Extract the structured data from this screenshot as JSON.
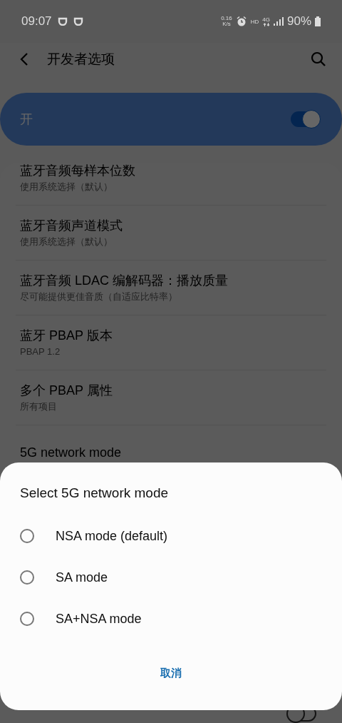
{
  "status_bar": {
    "time": "09:07",
    "speed": "0.16",
    "speed_unit": "K/s",
    "hd": "HD",
    "network": "4G",
    "battery": "90%"
  },
  "header": {
    "title": "开发者选项"
  },
  "master_switch": {
    "label": "开",
    "on": true
  },
  "settings": [
    {
      "kind": "text",
      "title": "蓝牙音频每样本位数",
      "subtitle": "使用系统选择（默认）"
    },
    {
      "kind": "text",
      "title": "蓝牙音频声道模式",
      "subtitle": "使用系统选择（默认）"
    },
    {
      "kind": "text",
      "title": "蓝牙音频 LDAC 编解码器：播放质量",
      "subtitle": "尽可能提供更佳音质（自适应比特率）"
    },
    {
      "kind": "text",
      "title": "蓝牙 PBAP 版本",
      "subtitle": "PBAP 1.2"
    },
    {
      "kind": "text",
      "title": "多个 PBAP 属性",
      "subtitle": "所有项目"
    },
    {
      "kind": "text",
      "title": "5G network mode"
    },
    {
      "kind": "switch",
      "on": false
    }
  ],
  "dialog": {
    "title": "Select 5G network mode",
    "options": [
      {
        "label": "NSA mode (default)",
        "selected": false
      },
      {
        "label": "SA mode",
        "selected": false
      },
      {
        "label": "SA+NSA mode",
        "selected": false
      }
    ],
    "buttons": [
      "取消"
    ]
  }
}
